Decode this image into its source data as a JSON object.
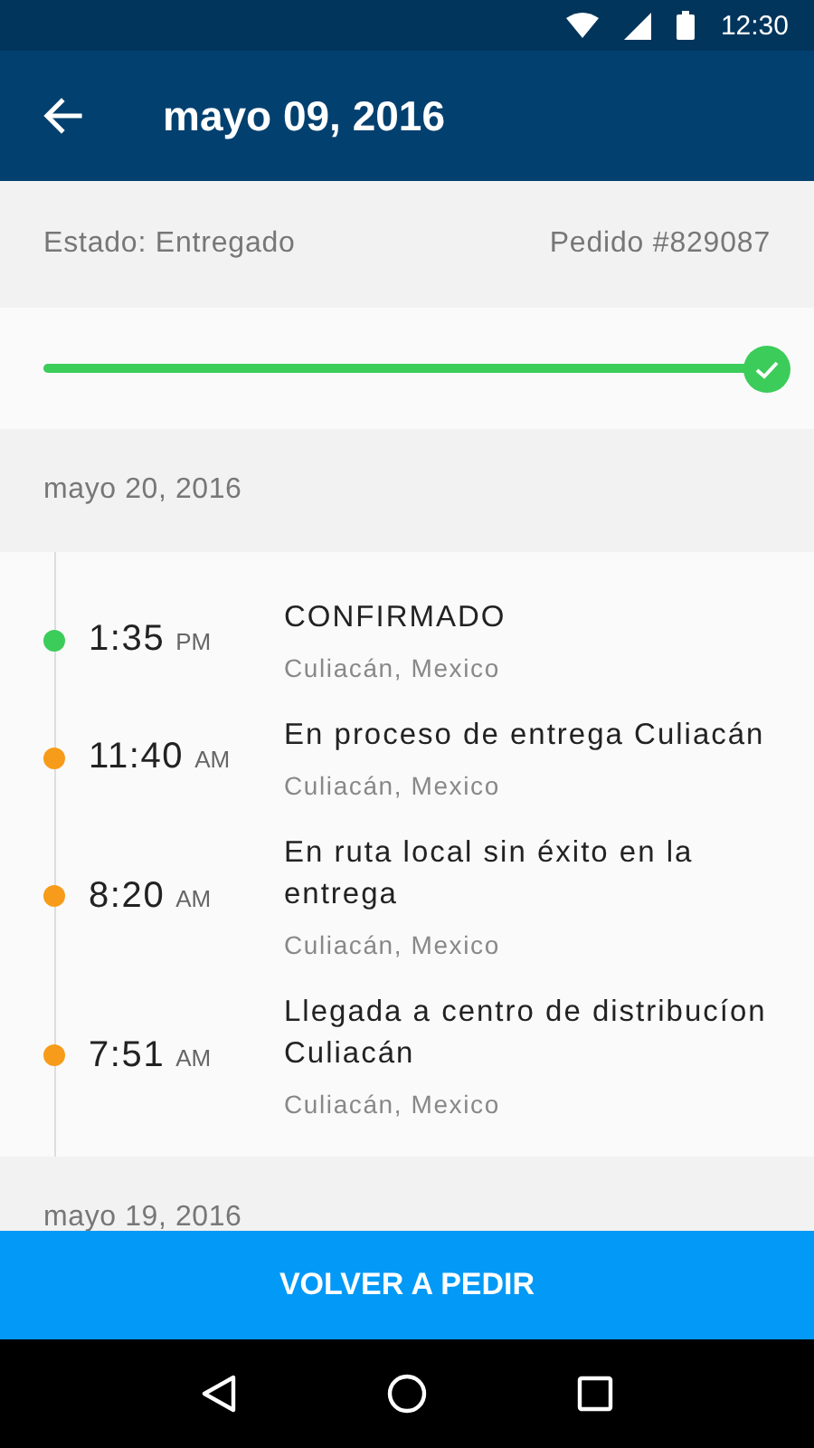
{
  "status_bar": {
    "time": "12:30"
  },
  "app_bar": {
    "title": "mayo 09, 2016"
  },
  "order": {
    "status": "Estado: Entregado",
    "number": "Pedido #829087"
  },
  "progress": {
    "level": 1.0
  },
  "groups": [
    {
      "date": "mayo 20, 2016",
      "events": [
        {
          "time": "1:35",
          "period": "PM",
          "title": "CONFIRMADO",
          "location": "Culiacán, Mexico",
          "color": "#3ccc5a"
        },
        {
          "time": "11:40",
          "period": "AM",
          "title": "En proceso de entrega Culiacán",
          "location": "Culiacán, Mexico",
          "color": "#f79c1a"
        },
        {
          "time": "8:20",
          "period": "AM",
          "title": "En ruta local sin éxito en la entrega",
          "location": "Culiacán, Mexico",
          "color": "#f79c1a"
        },
        {
          "time": "7:51",
          "period": "AM",
          "title": "Llegada a centro de distribucíon Culiacán",
          "location": "Culiacán, Mexico",
          "color": "#f79c1a"
        }
      ]
    },
    {
      "date": "mayo 19, 2016"
    }
  ],
  "button": {
    "label": "VOLVER A PEDIR"
  }
}
